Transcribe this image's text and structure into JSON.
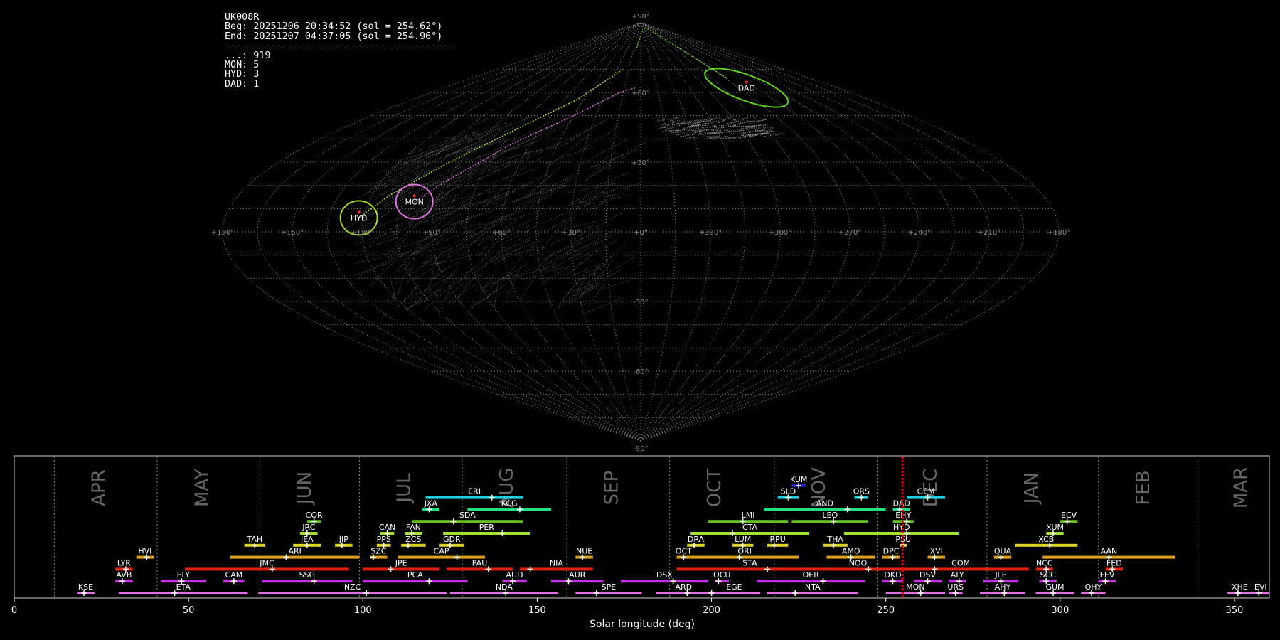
{
  "info": {
    "station": "UK008R",
    "begin": "Beg: 20251206 20:34:52 (sol = 254.62°)",
    "end": "End: 20251207 04:37:05 (sol = 254.96°)",
    "separator": "----------------------------------------",
    "counts": [
      {
        "code": "...",
        "n": 919
      },
      {
        "code": "MON",
        "n": 5
      },
      {
        "code": "HYD",
        "n": 3
      },
      {
        "code": "DAD",
        "n": 1
      }
    ]
  },
  "colors": {
    "background": "#000000",
    "grid": "#8a8a8a",
    "sporadic": "#9a9a9a",
    "hyd": "#a8e020",
    "mon": "#e070e0",
    "dad": "#60d020",
    "current_sol": "#e00000"
  },
  "chart_data": [
    {
      "type": "scatter",
      "projection": "sinusoidal",
      "x_ticks": [
        "+180°",
        "+150°",
        "+120°",
        "+90°",
        "+60°",
        "+30°",
        "+0°",
        "+330°",
        "+300°",
        "+270°",
        "+240°",
        "+210°",
        "+180°"
      ],
      "y_ticks": [
        "+90°",
        "+60°",
        "+30°",
        "+0°",
        "-30°",
        "-60°",
        "-90°"
      ],
      "radiants": [
        {
          "name": "HYD",
          "lon": 122,
          "lat": 6,
          "color_key": "hyd"
        },
        {
          "name": "MON",
          "lon": 100,
          "lat": 13,
          "color_key": "mon"
        },
        {
          "name": "DAD",
          "lon": 263,
          "lat": 62,
          "color_key": "dad"
        }
      ]
    },
    {
      "type": "bar",
      "xlabel": "Solar longitude (deg)",
      "xlim": [
        0,
        360
      ],
      "x_ticks": [
        0,
        50,
        100,
        150,
        200,
        250,
        300,
        350
      ],
      "current_sol": 254.8,
      "months": [
        {
          "label": "APR",
          "start": 11.5,
          "center": 24.5
        },
        {
          "label": "MAY",
          "start": 41.0,
          "center": 54.0
        },
        {
          "label": "JUN",
          "start": 70.5,
          "center": 83.5
        },
        {
          "label": "JUL",
          "start": 99.0,
          "center": 112.0
        },
        {
          "label": "AUG",
          "start": 128.5,
          "center": 141.5
        },
        {
          "label": "SEP",
          "start": 158.5,
          "center": 171.5
        },
        {
          "label": "OCT",
          "start": 188.0,
          "center": 201.0
        },
        {
          "label": "NOV",
          "start": 218.0,
          "center": 231.0
        },
        {
          "label": "DEC",
          "start": 247.5,
          "center": 263.0
        },
        {
          "label": "JAN",
          "start": 279.0,
          "center": 292.0
        },
        {
          "label": "FEB",
          "start": 311.0,
          "center": 324.0
        },
        {
          "label": "MAR",
          "start": 339.5,
          "center": 352.0
        }
      ],
      "showers": [
        {
          "code": "KUM",
          "start": 223,
          "end": 227,
          "peak": 225,
          "row": 10,
          "color": "#2020d0"
        },
        {
          "code": "ERI",
          "start": 118,
          "end": 146,
          "peak": 137,
          "row": 9,
          "color": "#20d0e0"
        },
        {
          "code": "SLD",
          "start": 219,
          "end": 225,
          "peak": 222,
          "row": 9,
          "color": "#20d0e0"
        },
        {
          "code": "ORS",
          "start": 241,
          "end": 245,
          "peak": 243,
          "row": 9,
          "color": "#20d0e0"
        },
        {
          "code": "GEM",
          "start": 256,
          "end": 267,
          "peak": 262,
          "row": 9,
          "color": "#20d0e0"
        },
        {
          "code": "JXA",
          "start": 117,
          "end": 122,
          "peak": 119,
          "row": 8,
          "color": "#20e080"
        },
        {
          "code": "KCG",
          "start": 130,
          "end": 154,
          "peak": 145,
          "row": 8,
          "color": "#20e080"
        },
        {
          "code": "AND",
          "start": 215,
          "end": 250,
          "peak": 239,
          "row": 8,
          "color": "#20e080"
        },
        {
          "code": "DAD",
          "start": 252,
          "end": 257,
          "peak": 254,
          "row": 8,
          "color": "#20e080"
        },
        {
          "code": "COR",
          "start": 84,
          "end": 88,
          "peak": 86,
          "row": 7,
          "color": "#60c020"
        },
        {
          "code": "SDA",
          "start": 114,
          "end": 146,
          "peak": 126,
          "row": 7,
          "color": "#60c020"
        },
        {
          "code": "LMI",
          "start": 199,
          "end": 222,
          "peak": 209,
          "row": 7,
          "color": "#60c020"
        },
        {
          "code": "LEO",
          "start": 223,
          "end": 245,
          "peak": 235,
          "row": 7,
          "color": "#60c020"
        },
        {
          "code": "EHY",
          "start": 252,
          "end": 258,
          "peak": 256,
          "row": 7,
          "color": "#60c020"
        },
        {
          "code": "ECV",
          "start": 300,
          "end": 305,
          "peak": 302,
          "row": 7,
          "color": "#60c020"
        },
        {
          "code": "JRC",
          "start": 82,
          "end": 87,
          "peak": 84,
          "row": 6,
          "color": "#a0e030"
        },
        {
          "code": "CAN",
          "start": 105,
          "end": 109,
          "peak": 107,
          "row": 6,
          "color": "#a0e030"
        },
        {
          "code": "FAN",
          "start": 112,
          "end": 117,
          "peak": 114,
          "row": 6,
          "color": "#a0e030"
        },
        {
          "code": "PER",
          "start": 123,
          "end": 148,
          "peak": 140,
          "row": 6,
          "color": "#a0e030"
        },
        {
          "code": "CTA",
          "start": 194,
          "end": 228,
          "peak": 206,
          "row": 6,
          "color": "#a0e030"
        },
        {
          "code": "HYD",
          "start": 238,
          "end": 271,
          "peak": 256,
          "row": 6,
          "color": "#a0e030"
        },
        {
          "code": "XUM",
          "start": 296,
          "end": 301,
          "peak": 298,
          "row": 6,
          "color": "#a0e030"
        },
        {
          "code": "TAH",
          "start": 66,
          "end": 72,
          "peak": 69,
          "row": 5,
          "color": "#e0d020"
        },
        {
          "code": "JEA",
          "start": 80,
          "end": 88,
          "peak": 84,
          "row": 5,
          "color": "#e0d020"
        },
        {
          "code": "JIP",
          "start": 92,
          "end": 97,
          "peak": 94,
          "row": 5,
          "color": "#e0d020"
        },
        {
          "code": "PPS",
          "start": 104,
          "end": 108,
          "peak": 106,
          "row": 5,
          "color": "#e0d020"
        },
        {
          "code": "ZCS",
          "start": 111,
          "end": 118,
          "peak": 113,
          "row": 5,
          "color": "#e0d020"
        },
        {
          "code": "GDR",
          "start": 122,
          "end": 129,
          "peak": 125,
          "row": 5,
          "color": "#e0d020"
        },
        {
          "code": "DRA",
          "start": 193,
          "end": 198,
          "peak": 195,
          "row": 5,
          "color": "#e0d020"
        },
        {
          "code": "LUM",
          "start": 206,
          "end": 212,
          "peak": 209,
          "row": 5,
          "color": "#e0d020"
        },
        {
          "code": "RPU",
          "start": 216,
          "end": 222,
          "peak": 218,
          "row": 5,
          "color": "#e0d020"
        },
        {
          "code": "THA",
          "start": 232,
          "end": 239,
          "peak": 235,
          "row": 5,
          "color": "#e0d020"
        },
        {
          "code": "PSU",
          "start": 254,
          "end": 256,
          "peak": 255,
          "row": 5,
          "color": "#e0d020"
        },
        {
          "code": "XCB",
          "start": 287,
          "end": 305,
          "peak": 297,
          "row": 5,
          "color": "#e0d020"
        },
        {
          "code": "HVI",
          "start": 35,
          "end": 40,
          "peak": 38,
          "row": 4,
          "color": "#e0a020"
        },
        {
          "code": "ARI",
          "start": 62,
          "end": 99,
          "peak": 78,
          "row": 4,
          "color": "#e0a020"
        },
        {
          "code": "SZC",
          "start": 102,
          "end": 107,
          "peak": 103,
          "row": 4,
          "color": "#e0a020"
        },
        {
          "code": "CAP",
          "start": 110,
          "end": 135,
          "peak": 127,
          "row": 4,
          "color": "#e0a020"
        },
        {
          "code": "NUE",
          "start": 161,
          "end": 166,
          "peak": 163,
          "row": 4,
          "color": "#e0a020"
        },
        {
          "code": "OCT",
          "start": 190,
          "end": 194,
          "peak": 192,
          "row": 4,
          "color": "#e0a020"
        },
        {
          "code": "ORI",
          "start": 194,
          "end": 225,
          "peak": 208,
          "row": 4,
          "color": "#e0a020"
        },
        {
          "code": "AMO",
          "start": 233,
          "end": 247,
          "peak": 240,
          "row": 4,
          "color": "#e0a020"
        },
        {
          "code": "DPC",
          "start": 249,
          "end": 254,
          "peak": 252,
          "row": 4,
          "color": "#e0a020"
        },
        {
          "code": "XVI",
          "start": 262,
          "end": 267,
          "peak": 264,
          "row": 4,
          "color": "#e0a020"
        },
        {
          "code": "QUA",
          "start": 281,
          "end": 286,
          "peak": 283,
          "row": 4,
          "color": "#e0a020"
        },
        {
          "code": "AAN",
          "start": 295,
          "end": 333,
          "peak": 314,
          "row": 4,
          "color": "#e0a020"
        },
        {
          "code": "LYR",
          "start": 29,
          "end": 34,
          "peak": 32,
          "row": 3,
          "color": "#e02010"
        },
        {
          "code": "JMC",
          "start": 49,
          "end": 96,
          "peak": 74,
          "row": 3,
          "color": "#e02010"
        },
        {
          "code": "JPE",
          "start": 100,
          "end": 122,
          "peak": 108,
          "row": 3,
          "color": "#e02010"
        },
        {
          "code": "PAU",
          "start": 124,
          "end": 143,
          "peak": 136,
          "row": 3,
          "color": "#e02010"
        },
        {
          "code": "NIA",
          "start": 145,
          "end": 166,
          "peak": 148,
          "row": 3,
          "color": "#e02010"
        },
        {
          "code": "STA",
          "start": 190,
          "end": 232,
          "peak": 216,
          "row": 3,
          "color": "#e02010"
        },
        {
          "code": "NOO",
          "start": 232,
          "end": 252,
          "peak": 245,
          "row": 3,
          "color": "#e02010"
        },
        {
          "code": "COM",
          "start": 252,
          "end": 291,
          "peak": 264,
          "row": 3,
          "color": "#e02010"
        },
        {
          "code": "NCC",
          "start": 293,
          "end": 298,
          "peak": 296,
          "row": 3,
          "color": "#e02010"
        },
        {
          "code": "FED",
          "start": 313,
          "end": 318,
          "peak": 315,
          "row": 3,
          "color": "#e02010"
        },
        {
          "code": "AVB",
          "start": 29,
          "end": 34,
          "peak": 31,
          "row": 2,
          "color": "#c030e0"
        },
        {
          "code": "ELY",
          "start": 42,
          "end": 55,
          "peak": 48,
          "row": 2,
          "color": "#c030e0"
        },
        {
          "code": "CAM",
          "start": 60,
          "end": 66,
          "peak": 63,
          "row": 2,
          "color": "#c030e0"
        },
        {
          "code": "SSG",
          "start": 71,
          "end": 97,
          "peak": 86,
          "row": 2,
          "color": "#c030e0"
        },
        {
          "code": "PCA",
          "start": 100,
          "end": 130,
          "peak": 119,
          "row": 2,
          "color": "#c030e0"
        },
        {
          "code": "AUD",
          "start": 140,
          "end": 147,
          "peak": 143,
          "row": 2,
          "color": "#c030e0"
        },
        {
          "code": "AUR",
          "start": 154,
          "end": 169,
          "peak": 159,
          "row": 2,
          "color": "#c030e0"
        },
        {
          "code": "DSX",
          "start": 174,
          "end": 199,
          "peak": 189,
          "row": 2,
          "color": "#c030e0"
        },
        {
          "code": "OCU",
          "start": 201,
          "end": 205,
          "peak": 202,
          "row": 2,
          "color": "#c030e0"
        },
        {
          "code": "OER",
          "start": 213,
          "end": 244,
          "peak": 232,
          "row": 2,
          "color": "#c030e0"
        },
        {
          "code": "DKD",
          "start": 249,
          "end": 255,
          "peak": 252,
          "row": 2,
          "color": "#c030e0"
        },
        {
          "code": "DSV",
          "start": 258,
          "end": 266,
          "peak": 262,
          "row": 2,
          "color": "#c030e0"
        },
        {
          "code": "ALY",
          "start": 268,
          "end": 273,
          "peak": 271,
          "row": 2,
          "color": "#c030e0"
        },
        {
          "code": "JLE",
          "start": 278,
          "end": 288,
          "peak": 283,
          "row": 2,
          "color": "#c030e0"
        },
        {
          "code": "SCC",
          "start": 294,
          "end": 299,
          "peak": 296,
          "row": 2,
          "color": "#c030e0"
        },
        {
          "code": "FEV",
          "start": 311,
          "end": 316,
          "peak": 313,
          "row": 2,
          "color": "#c030e0"
        },
        {
          "code": "KSE",
          "start": 18,
          "end": 23,
          "peak": 20,
          "row": 1,
          "color": "#e070e0"
        },
        {
          "code": "ETA",
          "start": 30,
          "end": 67,
          "peak": 46,
          "row": 1,
          "color": "#e070e0"
        },
        {
          "code": "NZC",
          "start": 70,
          "end": 124,
          "peak": 101,
          "row": 1,
          "color": "#e070e0"
        },
        {
          "code": "NDA",
          "start": 125,
          "end": 156,
          "peak": 141,
          "row": 1,
          "color": "#e070e0"
        },
        {
          "code": "SPE",
          "start": 161,
          "end": 180,
          "peak": 167,
          "row": 1,
          "color": "#e070e0"
        },
        {
          "code": "ARD",
          "start": 184,
          "end": 200,
          "peak": 193,
          "row": 1,
          "color": "#e070e0"
        },
        {
          "code": "EGE",
          "start": 199,
          "end": 214,
          "peak": 200,
          "row": 1,
          "color": "#e070e0"
        },
        {
          "code": "NTA",
          "start": 216,
          "end": 242,
          "peak": 224,
          "row": 1,
          "color": "#e070e0"
        },
        {
          "code": "MON",
          "start": 250,
          "end": 267,
          "peak": 260,
          "row": 1,
          "color": "#e070e0"
        },
        {
          "code": "URS",
          "start": 268,
          "end": 272,
          "peak": 270,
          "row": 1,
          "color": "#e070e0"
        },
        {
          "code": "AHY",
          "start": 277,
          "end": 290,
          "peak": 284,
          "row": 1,
          "color": "#e070e0"
        },
        {
          "code": "GUM",
          "start": 293,
          "end": 304,
          "peak": 298,
          "row": 1,
          "color": "#e070e0"
        },
        {
          "code": "OHY",
          "start": 306,
          "end": 313,
          "peak": 309,
          "row": 1,
          "color": "#e070e0"
        },
        {
          "code": "XHE",
          "start": 348,
          "end": 355,
          "peak": 351,
          "row": 1,
          "color": "#e070e0"
        },
        {
          "code": "EVI",
          "start": 355,
          "end": 360,
          "peak": 357,
          "row": 1,
          "color": "#e070e0"
        }
      ]
    }
  ]
}
